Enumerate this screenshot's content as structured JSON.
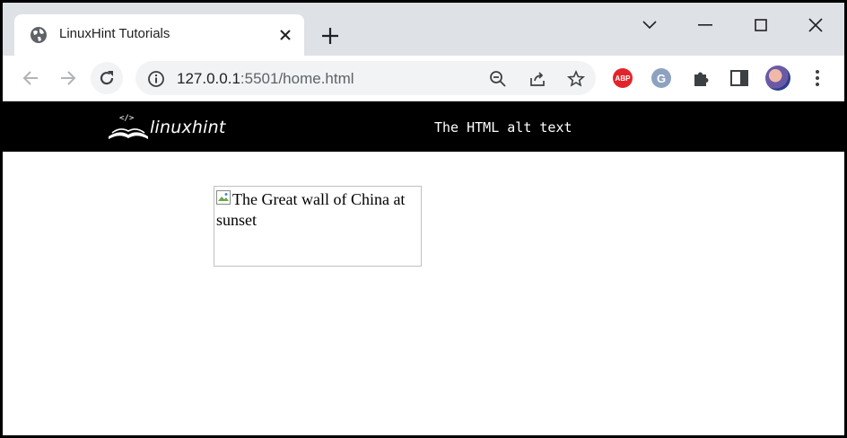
{
  "browser": {
    "tab": {
      "title": "LinuxHint Tutorials"
    },
    "address": {
      "host": "127.0.0.1",
      "rest": ":5501/home.html"
    },
    "icons": {
      "tab": "globe-icon",
      "close": "close-icon",
      "new_tab": "plus-icon",
      "tab_search": "chevron-down-icon",
      "minimize": "minimize-icon",
      "maximize": "maximize-icon",
      "window_close": "close-icon",
      "back": "arrow-left-icon",
      "forward": "arrow-right-icon",
      "reload": "reload-icon",
      "site_info": "info-icon",
      "zoom": "zoom-out-icon",
      "share": "share-icon",
      "bookmark": "star-icon",
      "extensions": "puzzle-icon",
      "side_panel": "side-panel-icon",
      "menu": "kebab-menu-icon"
    },
    "extensions": {
      "abp_label": "ABP",
      "grammarly_label": "G"
    }
  },
  "page": {
    "header": {
      "logo_text": "linuxhint",
      "logo_badge": "</>",
      "title": "The HTML alt text"
    },
    "image": {
      "alt": "The Great wall of China at sunset"
    }
  },
  "colors": {
    "tabstrip": "#dee1e6",
    "omnibox": "#f1f3f4",
    "header_bg": "#000000",
    "abp_red": "#e2242a"
  }
}
